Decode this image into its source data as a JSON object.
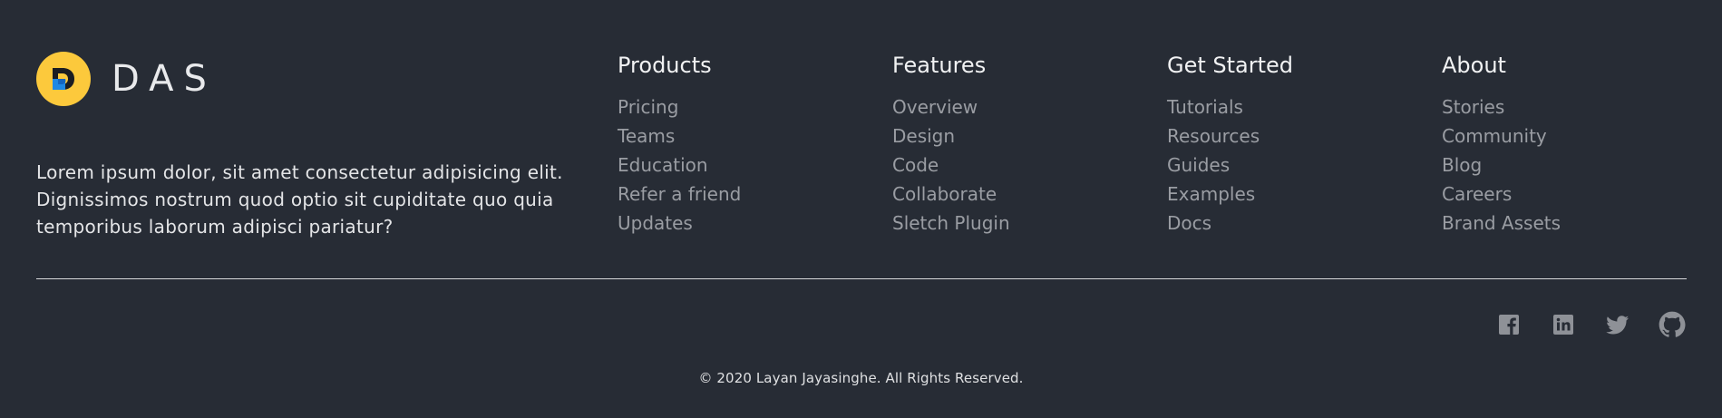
{
  "brand": {
    "logo_letter": "D",
    "name": "DAS",
    "description": "Lorem ipsum dolor, sit amet consectetur adipisicing elit. Dignissimos nostrum quod optio sit cupiditate quo quia temporibus laborum adipisci pariatur?"
  },
  "columns": [
    {
      "title": "Products",
      "links": [
        "Pricing",
        "Teams",
        "Education",
        "Refer a friend",
        "Updates"
      ]
    },
    {
      "title": "Features",
      "links": [
        "Overview",
        "Design",
        "Code",
        "Collaborate",
        "Sletch Plugin"
      ]
    },
    {
      "title": "Get Started",
      "links": [
        "Tutorials",
        "Resources",
        "Guides",
        "Examples",
        "Docs"
      ]
    },
    {
      "title": "About",
      "links": [
        "Stories",
        "Community",
        "Blog",
        "Careers",
        "Brand Assets"
      ]
    }
  ],
  "socials": [
    {
      "icon": "facebook-icon"
    },
    {
      "icon": "linkedin-icon"
    },
    {
      "icon": "twitter-icon"
    },
    {
      "icon": "github-icon"
    }
  ],
  "copyright": "© 2020 Layan Jayasinghe. All Rights Reserved.",
  "colors": {
    "background": "#272c35",
    "logo_yellow": "#fcc93c",
    "logo_blue": "#1e88e5",
    "link_grey": "#9a9da3",
    "heading_white": "#f1f2f3"
  }
}
